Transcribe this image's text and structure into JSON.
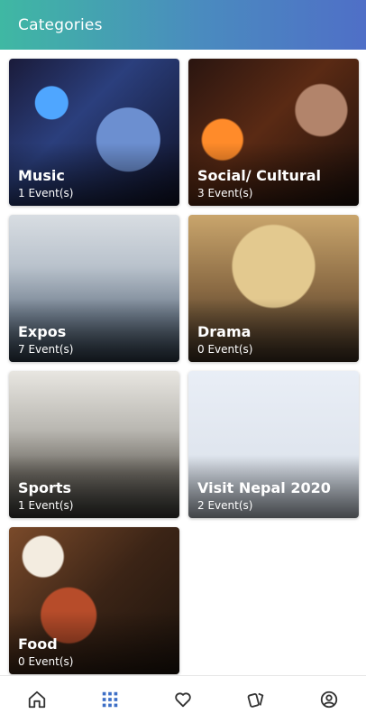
{
  "header": {
    "title": "Categories"
  },
  "categories": [
    {
      "name": "Music",
      "count": "1 Event(s)"
    },
    {
      "name": "Social/ Cultural",
      "count": "3 Event(s)"
    },
    {
      "name": "Expos",
      "count": "7 Event(s)"
    },
    {
      "name": "Drama",
      "count": "0 Event(s)"
    },
    {
      "name": "Sports",
      "count": "1 Event(s)"
    },
    {
      "name": "Visit Nepal 2020",
      "count": "2 Event(s)"
    },
    {
      "name": "Food",
      "count": "0 Event(s)"
    }
  ],
  "bottom_nav": {
    "items": [
      {
        "icon": "home-icon"
      },
      {
        "icon": "grid-icon",
        "active": true
      },
      {
        "icon": "heart-icon"
      },
      {
        "icon": "tickets-icon"
      },
      {
        "icon": "profile-icon"
      }
    ],
    "active_color": "#3d6fc6",
    "inactive_color": "#333333"
  },
  "colors": {
    "appbar_start": "#3fb8a3",
    "appbar_end": "#4f6fc7"
  }
}
